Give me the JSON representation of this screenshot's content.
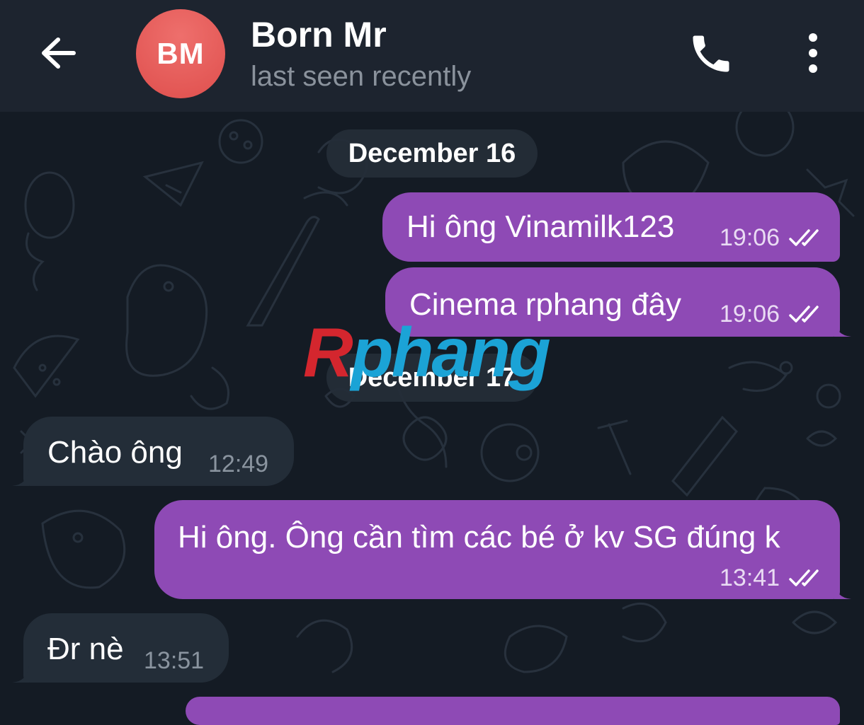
{
  "header": {
    "avatar_initials": "BM",
    "avatar_color": "#e85d5b",
    "name": "Born Mr",
    "status": "last seen recently",
    "icons": {
      "back": "back-arrow-icon",
      "call": "phone-icon",
      "menu": "more-vertical-icon"
    }
  },
  "chat": {
    "dates": [
      "December 16",
      "December 17"
    ],
    "messages": [
      {
        "text": "Hi ông Vinamilk123",
        "time": "19:06",
        "direction": "outgoing",
        "status": "read"
      },
      {
        "text": "Cinema rphang đây",
        "time": "19:06",
        "direction": "outgoing",
        "status": "read"
      },
      {
        "text": "Chào ông",
        "time": "12:49",
        "direction": "incoming"
      },
      {
        "text": "Hi ông. Ông cần tìm các bé ở kv SG đúng k",
        "time": "13:41",
        "direction": "outgoing",
        "status": "read"
      },
      {
        "text": "Đr nè",
        "time": "13:51",
        "direction": "incoming"
      }
    ]
  },
  "watermark": {
    "first": "R",
    "rest": "phang"
  },
  "colors": {
    "background": "#141b24",
    "header": "#1d242f",
    "outgoing_bubble": "#8e4ab5",
    "incoming_bubble": "#232d38",
    "date_chip": "#242d38"
  }
}
